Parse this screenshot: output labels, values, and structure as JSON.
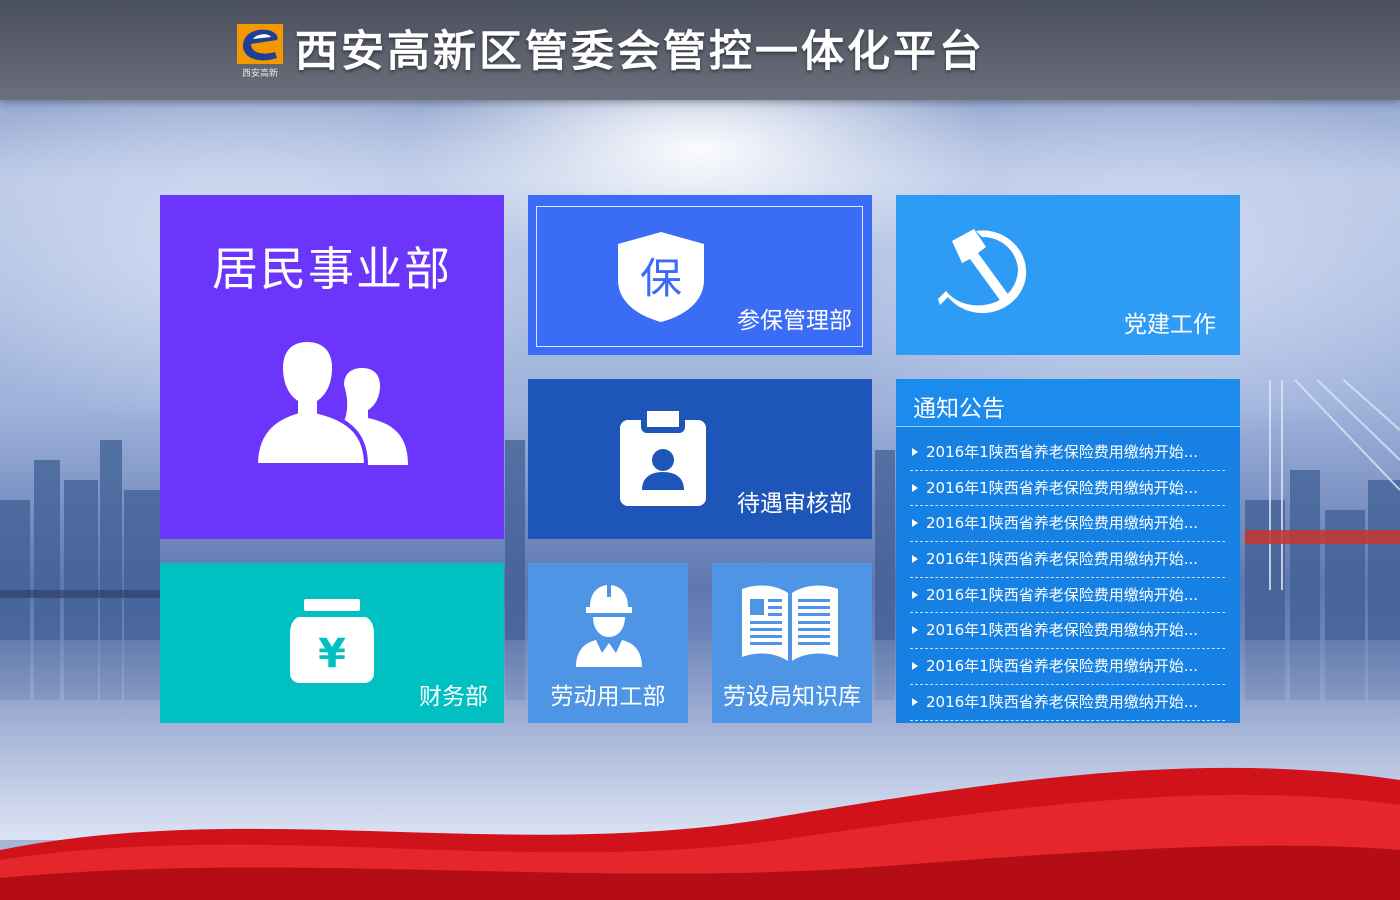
{
  "header": {
    "title": "西安高新区管委会管控一体化平台",
    "logo_text": "西安高新"
  },
  "tiles": {
    "resident": {
      "label": "居民事业部",
      "icon": "two-people-icon",
      "color": "#6b35fb"
    },
    "insurance": {
      "label": "参保管理部",
      "icon_text": "保",
      "icon": "shield-icon",
      "color": "#3a6cf5"
    },
    "party": {
      "label": "党建工作",
      "icon": "hammer-sickle-icon",
      "color": "#2e9cf5"
    },
    "review": {
      "label": "待遇审核部",
      "icon": "id-badge-icon",
      "color": "#1d56b8"
    },
    "finance": {
      "label": "财务部",
      "icon_text": "¥",
      "icon": "money-bag-icon",
      "color": "#00c0c1"
    },
    "labor": {
      "label": "劳动用工部",
      "icon": "worker-icon",
      "color": "#4f95e6"
    },
    "knowledge": {
      "label": "劳设局知识库",
      "icon": "open-book-icon",
      "color": "#4f95e6"
    }
  },
  "notice": {
    "title": "通知公告",
    "items": [
      "2016年1陕西省养老保险费用缴纳开始...",
      "2016年1陕西省养老保险费用缴纳开始...",
      "2016年1陕西省养老保险费用缴纳开始...",
      "2016年1陕西省养老保险费用缴纳开始...",
      "2016年1陕西省养老保险费用缴纳开始...",
      "2016年1陕西省养老保险费用缴纳开始...",
      "2016年1陕西省养老保险费用缴纳开始...",
      "2016年1陕西省养老保险费用缴纳开始..."
    ]
  }
}
